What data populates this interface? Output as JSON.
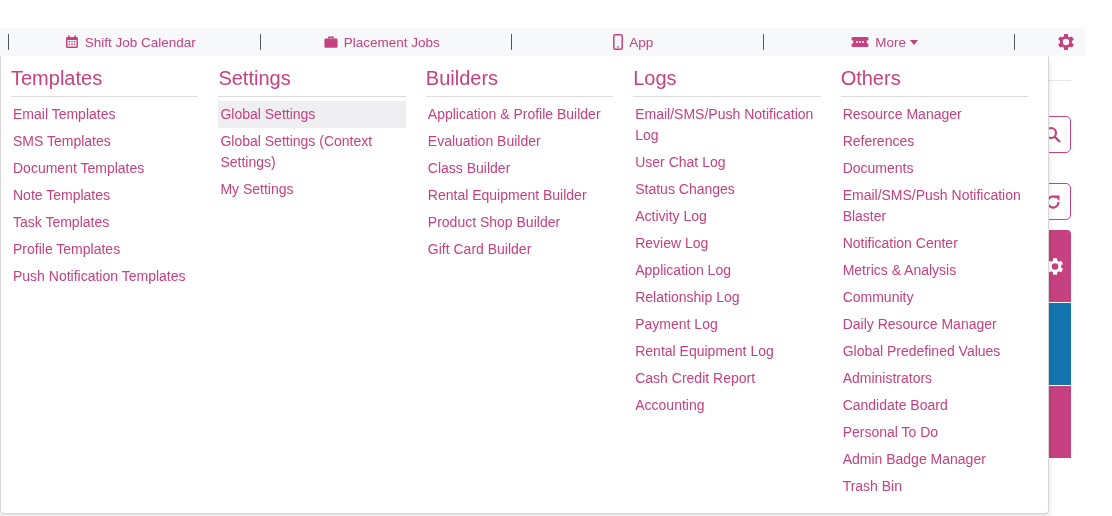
{
  "nav": [
    {
      "label": "Shift Job Calendar",
      "dropdown": false
    },
    {
      "label": "Placement Jobs",
      "dropdown": false
    },
    {
      "label": "App",
      "dropdown": false
    },
    {
      "label": "More",
      "dropdown": true
    }
  ],
  "menu": [
    {
      "heading": "Templates",
      "items": [
        {
          "label": "Email Templates",
          "selected": false
        },
        {
          "label": "SMS Templates",
          "selected": false
        },
        {
          "label": "Document Templates",
          "selected": false
        },
        {
          "label": "Note Templates",
          "selected": false
        },
        {
          "label": "Task Templates",
          "selected": false
        },
        {
          "label": "Profile Templates",
          "selected": false
        },
        {
          "label": "Push Notification Templates",
          "selected": false
        }
      ]
    },
    {
      "heading": "Settings",
      "items": [
        {
          "label": "Global Settings",
          "selected": true
        },
        {
          "label": "Global Settings (Context Settings)",
          "selected": false
        },
        {
          "label": "My Settings",
          "selected": false
        }
      ]
    },
    {
      "heading": "Builders",
      "items": [
        {
          "label": "Application & Profile Builder",
          "selected": false
        },
        {
          "label": "Evaluation Builder",
          "selected": false
        },
        {
          "label": "Class Builder",
          "selected": false
        },
        {
          "label": "Rental Equipment Builder",
          "selected": false
        },
        {
          "label": "Product Shop Builder",
          "selected": false
        },
        {
          "label": "Gift Card Builder",
          "selected": false
        }
      ]
    },
    {
      "heading": "Logs",
      "items": [
        {
          "label": "Email/SMS/Push Notification Log",
          "selected": false
        },
        {
          "label": "User Chat Log",
          "selected": false
        },
        {
          "label": "Status Changes",
          "selected": false
        },
        {
          "label": "Activity Log",
          "selected": false
        },
        {
          "label": "Review Log",
          "selected": false
        },
        {
          "label": "Application Log",
          "selected": false
        },
        {
          "label": "Relationship Log",
          "selected": false
        },
        {
          "label": "Payment Log",
          "selected": false
        },
        {
          "label": "Rental Equipment Log",
          "selected": false
        },
        {
          "label": "Cash Credit Report",
          "selected": false
        },
        {
          "label": "Accounting",
          "selected": false
        }
      ]
    },
    {
      "heading": "Others",
      "items": [
        {
          "label": "Resource Manager",
          "selected": false
        },
        {
          "label": "References",
          "selected": false
        },
        {
          "label": "Documents",
          "selected": false
        },
        {
          "label": "Email/SMS/Push Notification Blaster",
          "selected": false
        },
        {
          "label": "Notification Center",
          "selected": false
        },
        {
          "label": "Metrics & Analysis",
          "selected": false
        },
        {
          "label": "Community",
          "selected": false
        },
        {
          "label": "Daily Resource Manager",
          "selected": false
        },
        {
          "label": "Global Predefined Values",
          "selected": false
        },
        {
          "label": "Administrators",
          "selected": false
        },
        {
          "label": "Candidate Board",
          "selected": false
        },
        {
          "label": "Personal To Do",
          "selected": false
        },
        {
          "label": "Admin Badge Manager",
          "selected": false
        },
        {
          "label": "Trash Bin",
          "selected": false
        }
      ]
    }
  ],
  "side": [
    {
      "kind": "search"
    },
    {
      "kind": "refresh"
    },
    {
      "kind": "panel",
      "color": "#c6417f"
    },
    {
      "kind": "block",
      "color": "#1474ae"
    },
    {
      "kind": "block",
      "color": "#c6417f"
    }
  ]
}
